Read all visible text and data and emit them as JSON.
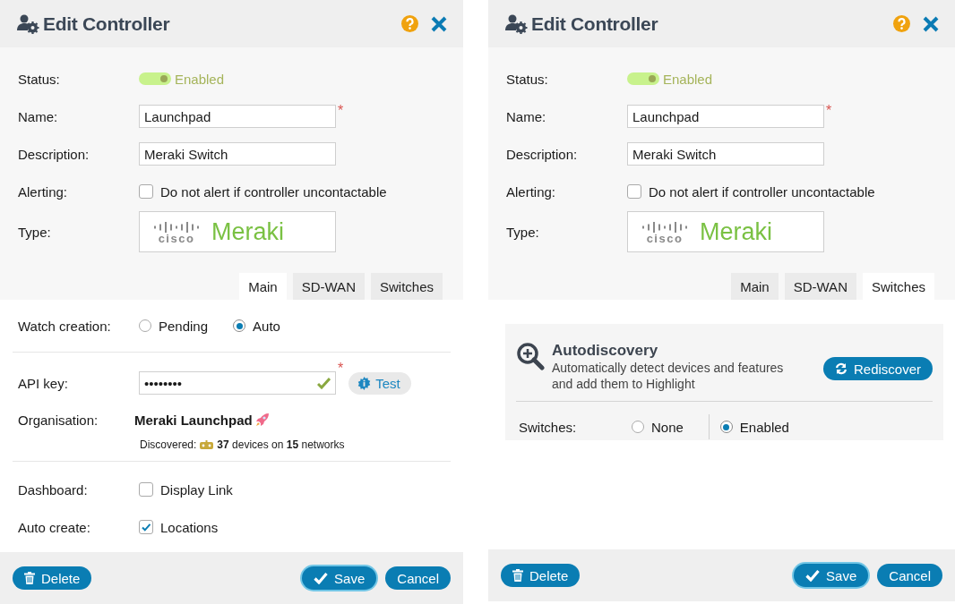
{
  "dialogs": [
    {
      "title": "Edit Controller",
      "status": {
        "label": "Status:",
        "value": "Enabled",
        "on": true
      },
      "name": {
        "label": "Name:",
        "value": "Launchpad",
        "required": "*"
      },
      "description": {
        "label": "Description:",
        "value": "Meraki Switch"
      },
      "alerting": {
        "label": "Alerting:",
        "option": "Do not alert if controller uncontactable",
        "checked": false
      },
      "type": {
        "label": "Type:",
        "brand": "cisco",
        "product": "Meraki"
      },
      "tabs": [
        {
          "label": "Main",
          "selected": true
        },
        {
          "label": "SD-WAN",
          "selected": false
        },
        {
          "label": "Switches",
          "selected": false
        }
      ],
      "panel": {
        "kind": "main",
        "watch_creation": {
          "label": "Watch creation:",
          "options": [
            {
              "label": "Pending",
              "selected": false
            },
            {
              "label": "Auto",
              "selected": true
            }
          ]
        },
        "api_key": {
          "label": "API key:",
          "value": "••••••••",
          "valid": true,
          "required": "*",
          "test": "Test"
        },
        "organisation": {
          "label": "Organisation:",
          "name": "Meraki Launchpad",
          "discovered": "Discovered:",
          "summary": "**37** devices on **15** networks"
        },
        "dashboard": {
          "label": "Dashboard:",
          "option": "Display Link",
          "checked": false
        },
        "auto_create": {
          "label": "Auto create:",
          "option": "Locations",
          "checked": true
        }
      },
      "footer": {
        "delete": "Delete",
        "save": "Save",
        "cancel": "Cancel"
      }
    },
    {
      "title": "Edit Controller",
      "status": {
        "label": "Status:",
        "value": "Enabled",
        "on": true
      },
      "name": {
        "label": "Name:",
        "value": "Launchpad",
        "required": "*"
      },
      "description": {
        "label": "Description:",
        "value": "Meraki Switch"
      },
      "alerting": {
        "label": "Alerting:",
        "option": "Do not alert if controller uncontactable",
        "checked": false
      },
      "type": {
        "label": "Type:",
        "brand": "cisco",
        "product": "Meraki"
      },
      "tabs": [
        {
          "label": "Main",
          "selected": false
        },
        {
          "label": "SD-WAN",
          "selected": false
        },
        {
          "label": "Switches",
          "selected": true
        }
      ],
      "panel": {
        "kind": "switches",
        "autodiscovery": {
          "title": "Autodiscovery",
          "description": "Automatically detect devices and features and add them to Highlight",
          "button": "Rediscover"
        },
        "switches": {
          "label": "Switches:",
          "options": [
            {
              "label": "None",
              "selected": false
            },
            {
              "label": "Enabled",
              "selected": true
            }
          ]
        }
      },
      "footer": {
        "delete": "Delete",
        "save": "Save",
        "cancel": "Cancel"
      }
    }
  ]
}
